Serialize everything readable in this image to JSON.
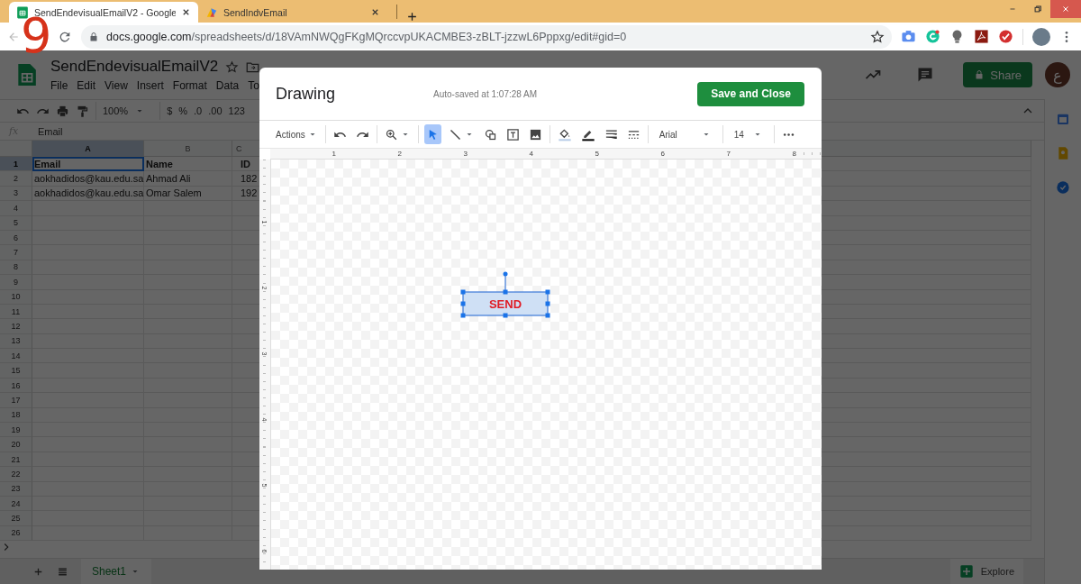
{
  "browser": {
    "tabs": [
      {
        "title": "SendEndevisualEmailV2 - Google",
        "selected": true
      },
      {
        "title": "SendIndvEmail",
        "selected": false
      }
    ],
    "url_host": "docs.google.com",
    "url_path": "/spreadsheets/d/18VAmNWQgFKgMQrccvpUKACMBE3-zBLT-jzzwL6Pppxg/edit#gid=0"
  },
  "step_number": "9",
  "sheets": {
    "title": "SendEndevisualEmailV2",
    "menu": [
      "File",
      "Edit",
      "View",
      "Insert",
      "Format",
      "Data",
      "To"
    ],
    "share": "Share",
    "avatar": "ع",
    "toolbar": {
      "zoom": "100%",
      "currency": "$",
      "percent": "%",
      "dec_less": ".0",
      "dec_more": ".00",
      "format": "123"
    },
    "formula_label": "fx",
    "formula": "Email",
    "columns": [
      {
        "label": "A",
        "selected": true
      },
      {
        "label": "B",
        "selected": false
      },
      {
        "label": "C",
        "selected": false
      }
    ],
    "rows": [
      {
        "number": "1",
        "selected": true,
        "cells": [
          "Email",
          "Name",
          "ID"
        ]
      },
      {
        "number": "2",
        "selected": false,
        "cells": [
          "aokhadidos@kau.edu.sa",
          "Ahmad Ali",
          "182"
        ]
      },
      {
        "number": "3",
        "selected": false,
        "cells": [
          "aokhadidos@kau.edu.sa",
          "Omar Salem",
          "192"
        ]
      },
      {
        "number": "4",
        "selected": false,
        "cells": []
      },
      {
        "number": "5",
        "selected": false,
        "cells": []
      },
      {
        "number": "6",
        "selected": false,
        "cells": []
      },
      {
        "number": "7",
        "selected": false,
        "cells": []
      },
      {
        "number": "8",
        "selected": false,
        "cells": []
      },
      {
        "number": "9",
        "selected": false,
        "cells": []
      },
      {
        "number": "10",
        "selected": false,
        "cells": []
      },
      {
        "number": "11",
        "selected": false,
        "cells": []
      },
      {
        "number": "12",
        "selected": false,
        "cells": []
      },
      {
        "number": "13",
        "selected": false,
        "cells": []
      },
      {
        "number": "14",
        "selected": false,
        "cells": []
      },
      {
        "number": "15",
        "selected": false,
        "cells": []
      },
      {
        "number": "16",
        "selected": false,
        "cells": []
      },
      {
        "number": "17",
        "selected": false,
        "cells": []
      },
      {
        "number": "18",
        "selected": false,
        "cells": []
      },
      {
        "number": "19",
        "selected": false,
        "cells": []
      },
      {
        "number": "20",
        "selected": false,
        "cells": []
      },
      {
        "number": "21",
        "selected": false,
        "cells": []
      },
      {
        "number": "22",
        "selected": false,
        "cells": []
      },
      {
        "number": "23",
        "selected": false,
        "cells": []
      },
      {
        "number": "24",
        "selected": false,
        "cells": []
      },
      {
        "number": "25",
        "selected": false,
        "cells": []
      },
      {
        "number": "26",
        "selected": false,
        "cells": []
      }
    ],
    "sheet_tabs": [
      {
        "label": "Sheet1",
        "selected": true
      }
    ],
    "explore": "Explore"
  },
  "dialog": {
    "title": "Drawing",
    "autosave": "Auto-saved at 1:07:28 AM",
    "save": "Save and Close",
    "tool_groups": [
      [
        {
          "kind": "menu",
          "label": "Actions",
          "selected": false
        }
      ],
      [
        {
          "kind": "undo",
          "selected": false
        },
        {
          "kind": "redo",
          "selected": false
        }
      ],
      [
        {
          "kind": "zoom",
          "selected": false
        }
      ],
      [
        {
          "kind": "select",
          "selected": true
        },
        {
          "kind": "line",
          "selected": false
        },
        {
          "kind": "shape",
          "selected": false
        },
        {
          "kind": "textbox",
          "selected": false
        },
        {
          "kind": "image",
          "selected": false
        }
      ],
      [
        {
          "kind": "fill",
          "selected": false
        },
        {
          "kind": "pen",
          "selected": false
        },
        {
          "kind": "weight",
          "selected": false
        },
        {
          "kind": "dash",
          "selected": false
        }
      ],
      [
        {
          "kind": "dropdown",
          "label": "Arial",
          "selected": false
        }
      ],
      [
        {
          "kind": "dropdown",
          "label": "14",
          "selected": false
        }
      ],
      [
        {
          "kind": "more",
          "selected": false
        }
      ]
    ],
    "ruler_h": [
      "1",
      "2",
      "3",
      "4",
      "5",
      "6",
      "7",
      "8"
    ],
    "ruler_v": [
      "1",
      "2",
      "3",
      "4",
      "5",
      "6"
    ],
    "shape": {
      "label": "SEND",
      "selected": true
    }
  }
}
